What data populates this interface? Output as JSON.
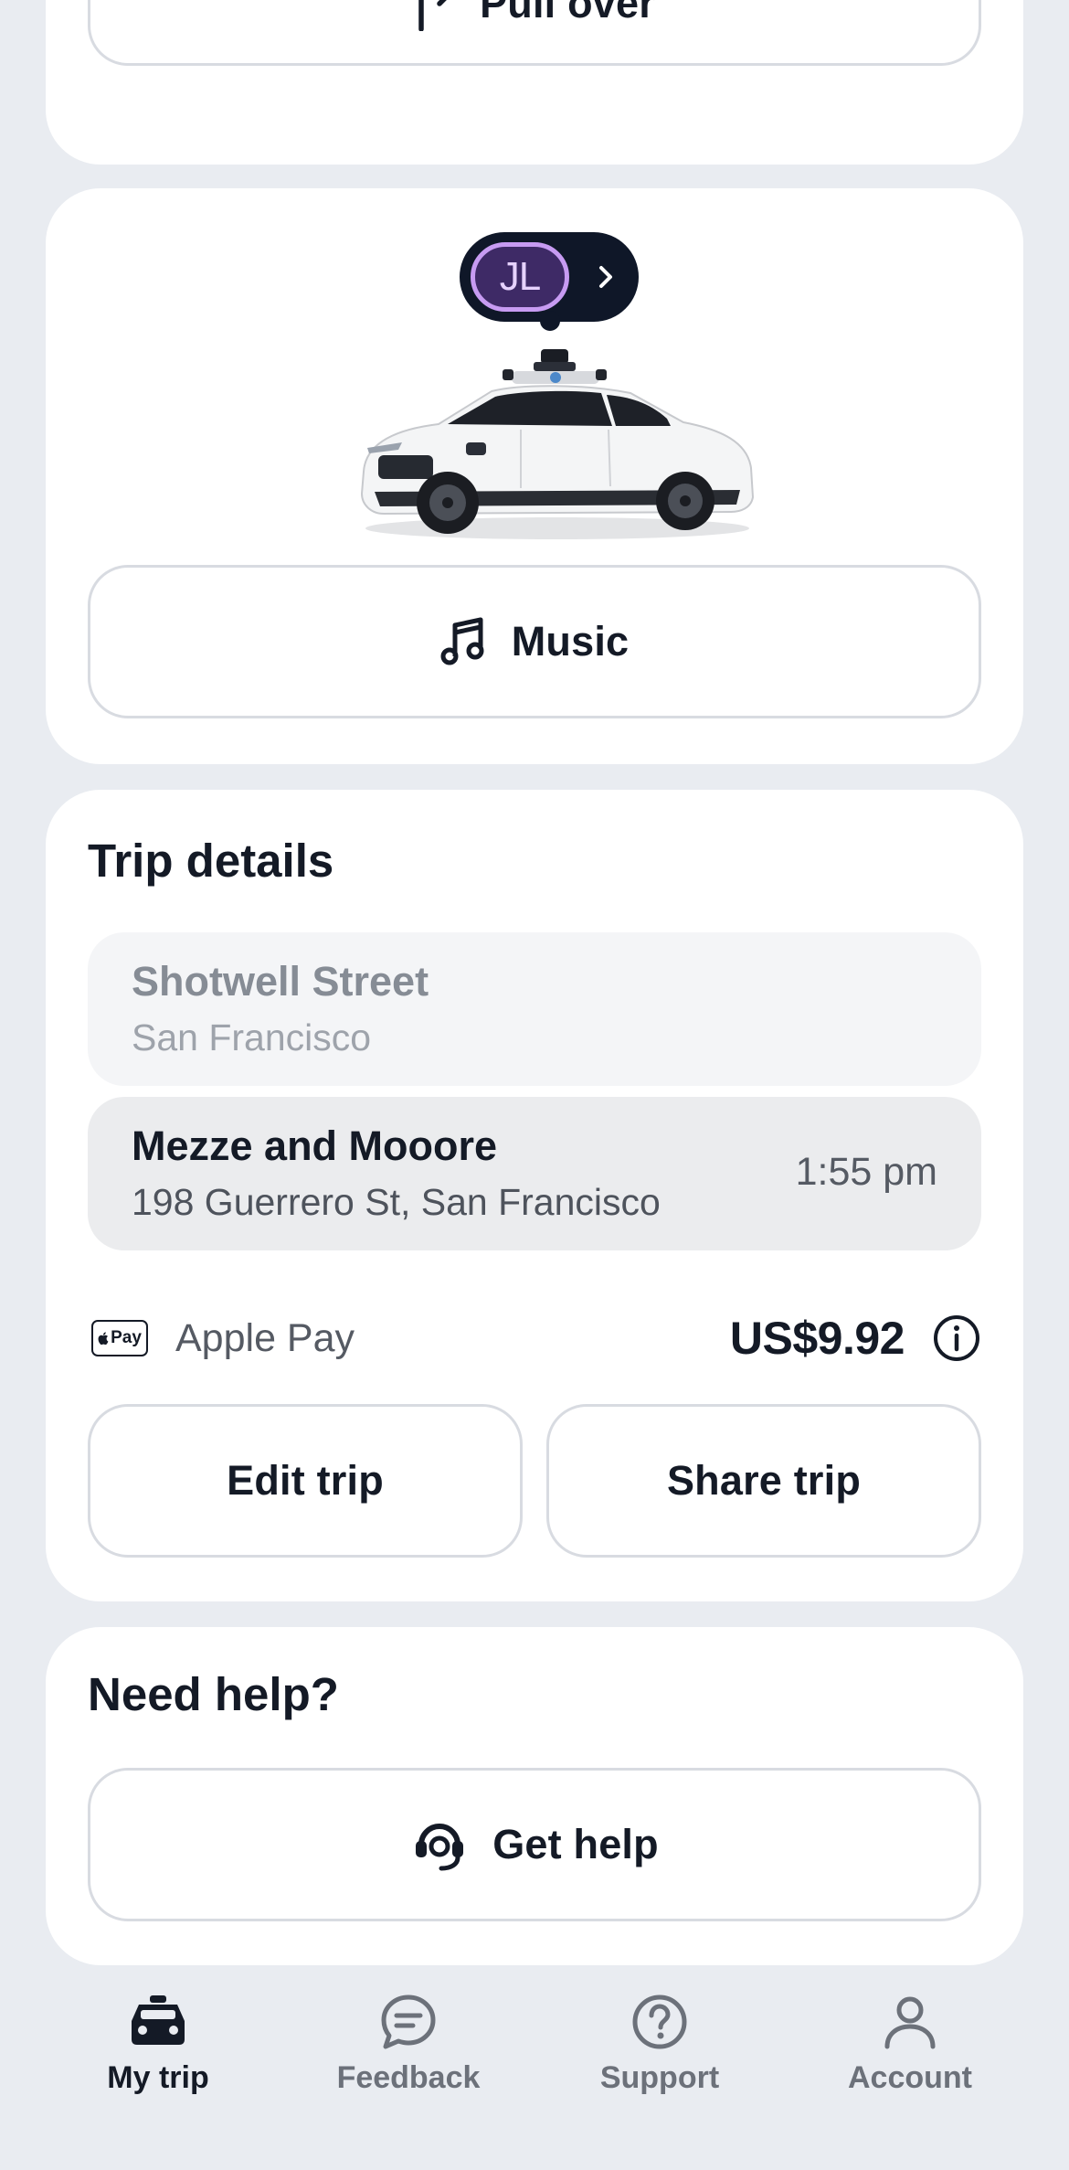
{
  "top_card": {
    "pull_over_label": "Pull over"
  },
  "car_card": {
    "rider_initials": "JL",
    "music_label": "Music"
  },
  "trip": {
    "title": "Trip details",
    "origin": {
      "name": "Shotwell Street",
      "city": "San Francisco"
    },
    "destination": {
      "name": "Mezze and Mooore",
      "address": "198 Guerrero St, San Francisco",
      "eta": "1:55 pm"
    },
    "payment": {
      "badge": "Pay",
      "method": "Apple Pay",
      "price": "US$9.92"
    },
    "edit_label": "Edit trip",
    "share_label": "Share trip"
  },
  "help": {
    "title": "Need help?",
    "get_help_label": "Get help"
  },
  "nav": {
    "items": [
      {
        "label": "My trip",
        "icon": "car-icon",
        "active": true
      },
      {
        "label": "Feedback",
        "icon": "chat-bubble-icon",
        "active": false
      },
      {
        "label": "Support",
        "icon": "question-circle-icon",
        "active": false
      },
      {
        "label": "Account",
        "icon": "person-icon",
        "active": false
      }
    ]
  },
  "colors": {
    "background": "#e9ecf1",
    "card": "#ffffff",
    "text_primary": "#141a26",
    "rider_badge_accent": "#c79bf2",
    "pill_dark": "#0f1728"
  }
}
